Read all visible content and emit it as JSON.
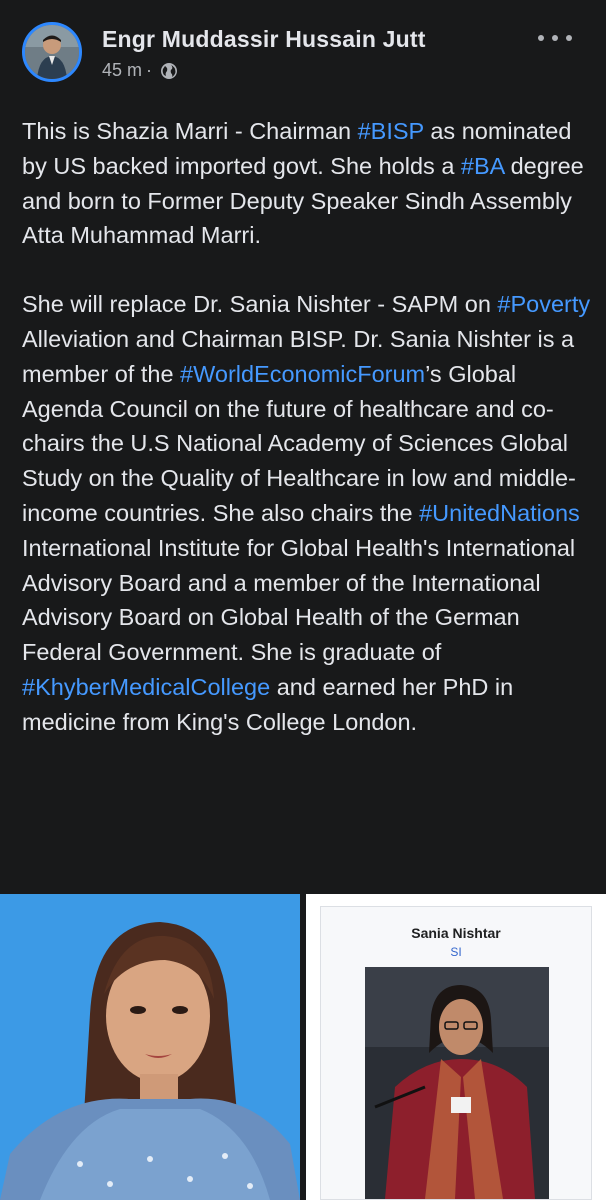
{
  "post": {
    "author": "Engr Muddassir Hussain Jutt",
    "time": "45 m",
    "separator": "·",
    "paragraph1": [
      {
        "text": "This is Shazia Marri - Chairman ",
        "tag": false
      },
      {
        "text": "#BISP",
        "tag": true
      },
      {
        "text": " as nominated by US backed imported govt. She holds a ",
        "tag": false
      },
      {
        "text": "#BA",
        "tag": true
      },
      {
        "text": " degree and born to Former Deputy Speaker Sindh Assembly Atta Muhammad Marri.",
        "tag": false
      }
    ],
    "paragraph2": [
      {
        "text": "She will replace Dr. Sania Nishter - SAPM on ",
        "tag": false
      },
      {
        "text": "#Poverty",
        "tag": true
      },
      {
        "text": " Alleviation and Chairman BISP. Dr. Sania Nishter is a member of the ",
        "tag": false
      },
      {
        "text": "#WorldEconomicForum",
        "tag": true
      },
      {
        "text": "’s Global Agenda Council on the future of healthcare and co-chairs the U.S National Academy of Sciences Global Study on the Quality of Healthcare in low and middle-income countries. She also chairs the ",
        "tag": false
      },
      {
        "text": "#UnitedNations",
        "tag": true
      },
      {
        "text": " International Institute for Global Health's International Advisory Board and a member of the International Advisory Board on Global Health of the German Federal Government. She is graduate of ",
        "tag": false
      },
      {
        "text": "#KhyberMedicalCollege",
        "tag": true
      },
      {
        "text": " and earned her PhD in medicine from King's College London.",
        "tag": false
      }
    ]
  },
  "photos": {
    "right_card": {
      "title": "Sania Nishtar",
      "subtitle": "SI"
    }
  },
  "icons": {
    "privacy": "globe-icon",
    "menu": "more-options-icon",
    "profile": "avatar"
  },
  "colors": {
    "background": "#18191a",
    "text": "#e4e6eb",
    "secondary_text": "#b0b3b8",
    "hashtag": "#4599ff",
    "avatar_ring": "#2d88ff"
  }
}
